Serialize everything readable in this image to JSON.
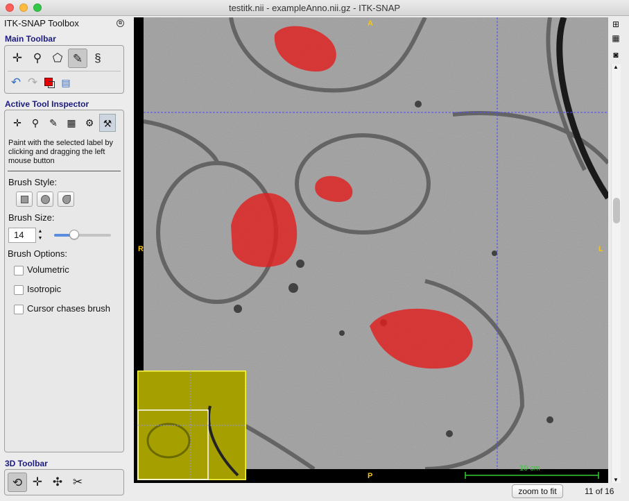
{
  "window": {
    "title": "testitk.nii - exampleAnno.nii.gz - ITK-SNAP"
  },
  "toolbox": {
    "title": "ITK-SNAP Toolbox",
    "main_toolbar_title": "Main Toolbar",
    "main_tools": [
      "crosshair-icon",
      "zoom-icon",
      "polygon-icon",
      "paintbrush-icon",
      "snake-icon"
    ],
    "active_tool": "paintbrush-icon",
    "history_tools": [
      "undo-icon",
      "redo-icon",
      "label-color-icon",
      "label-editor-icon"
    ],
    "inspector_title": "Active Tool Inspector",
    "inspector_tabs": [
      "crosshair-icon",
      "zoom-icon",
      "paintbrush-icon",
      "layer-icon",
      "gear-icon",
      "tools-icon"
    ],
    "help_text": "Paint with the selected label by clicking and dragging the left mouse button",
    "brush_style_label": "Brush Style:",
    "brush_size_label": "Brush Size:",
    "brush_size_value": "14",
    "brush_size_fraction": 0.35,
    "brush_options_label": "Brush Options:",
    "options": [
      {
        "label": "Volumetric",
        "checked": false
      },
      {
        "label": "Isotropic",
        "checked": false
      },
      {
        "label": "Cursor chases brush",
        "checked": false
      }
    ],
    "toolbar3d_title": "3D Toolbar"
  },
  "viewer": {
    "orientation": {
      "top": "A",
      "bottom": "P",
      "left": "R",
      "right": "L"
    },
    "scale_label": "10 cm",
    "label_color": "#e02020",
    "crosshair_color": "#4a4aff"
  },
  "status": {
    "zoom_button": "zoom to fit",
    "slice": "11 of 16"
  }
}
